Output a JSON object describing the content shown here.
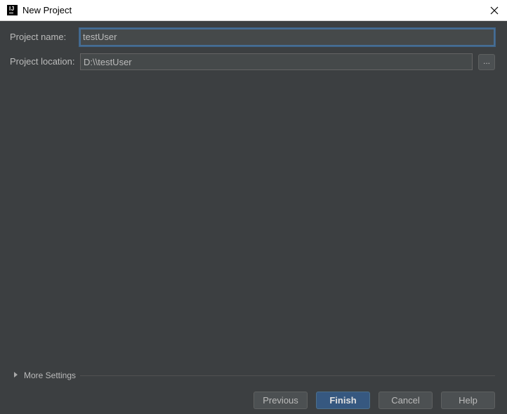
{
  "window": {
    "title": "New Project",
    "app_icon_label": "IJ"
  },
  "form": {
    "project_name_label": "Project name:",
    "project_name_value": "testUser",
    "project_location_label": "Project location:",
    "project_location_value": "D:\\\\testUser",
    "browse_label": "..."
  },
  "more_settings": {
    "label": "More Settings"
  },
  "buttons": {
    "previous": "Previous",
    "finish": "Finish",
    "cancel": "Cancel",
    "help": "Help"
  },
  "icons": {
    "app": "intellij-icon",
    "close": "close-icon",
    "expand": "expand-triangle-icon"
  }
}
